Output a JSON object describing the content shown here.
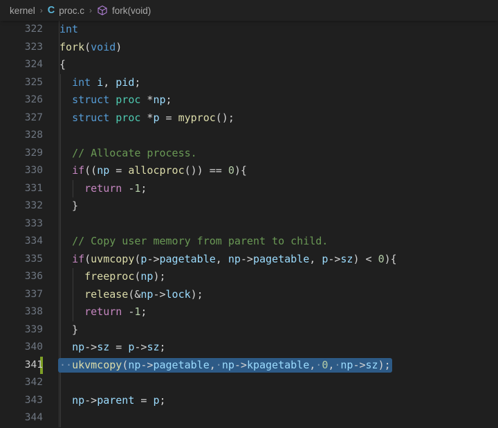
{
  "breadcrumb": {
    "items": [
      {
        "label": "kernel",
        "icon": null
      },
      {
        "label": "proc.c",
        "icon": "c-file-icon"
      },
      {
        "label": "fork(void)",
        "icon": "symbol-method-cube-icon"
      }
    ],
    "separator": "›"
  },
  "editor": {
    "language": "c",
    "theme": "dark",
    "current_line": 341,
    "selection_line": 341,
    "modified_gutter_lines": [
      341
    ],
    "whitespace_dot": "·",
    "colors": {
      "background": "#1f1f1f",
      "breadcrumb_background": "#212121",
      "line_number": "#6e7681",
      "line_number_active": "#cccccc",
      "selection": "#2d5a86",
      "gutter_modified": "#7ea026",
      "indent_guide": "#3b3b3b",
      "keyword": "#569cd6",
      "control": "#c586c0",
      "type": "#4ec9b0",
      "function": "#dcdcaa",
      "variable": "#9cdcfe",
      "number": "#b5cea8",
      "comment": "#6a9955",
      "punctuation": "#d4d4d4"
    },
    "lines": [
      {
        "n": "322",
        "tokens": [
          {
            "t": "int",
            "c": "kw"
          }
        ]
      },
      {
        "n": "323",
        "tokens": [
          {
            "t": "fork",
            "c": "fn"
          },
          {
            "t": "(",
            "c": "punc"
          },
          {
            "t": "void",
            "c": "kw"
          },
          {
            "t": ")",
            "c": "punc"
          }
        ]
      },
      {
        "n": "324",
        "tokens": [
          {
            "t": "{",
            "c": "punc"
          }
        ]
      },
      {
        "n": "325",
        "indents": [
          1
        ],
        "tokens": [
          {
            "t": "  ",
            "c": "punc"
          },
          {
            "t": "int",
            "c": "kw"
          },
          {
            "t": " ",
            "c": "punc"
          },
          {
            "t": "i",
            "c": "var"
          },
          {
            "t": ", ",
            "c": "punc"
          },
          {
            "t": "pid",
            "c": "var"
          },
          {
            "t": ";",
            "c": "punc"
          }
        ]
      },
      {
        "n": "326",
        "indents": [
          1
        ],
        "tokens": [
          {
            "t": "  ",
            "c": "punc"
          },
          {
            "t": "struct",
            "c": "kw"
          },
          {
            "t": " ",
            "c": "punc"
          },
          {
            "t": "proc",
            "c": "type"
          },
          {
            "t": " *",
            "c": "punc"
          },
          {
            "t": "np",
            "c": "var"
          },
          {
            "t": ";",
            "c": "punc"
          }
        ]
      },
      {
        "n": "327",
        "indents": [
          1
        ],
        "tokens": [
          {
            "t": "  ",
            "c": "punc"
          },
          {
            "t": "struct",
            "c": "kw"
          },
          {
            "t": " ",
            "c": "punc"
          },
          {
            "t": "proc",
            "c": "type"
          },
          {
            "t": " *",
            "c": "punc"
          },
          {
            "t": "p",
            "c": "var"
          },
          {
            "t": " = ",
            "c": "punc"
          },
          {
            "t": "myproc",
            "c": "fn"
          },
          {
            "t": "();",
            "c": "punc"
          }
        ]
      },
      {
        "n": "328",
        "indents": [
          1
        ],
        "tokens": []
      },
      {
        "n": "329",
        "indents": [
          1
        ],
        "tokens": [
          {
            "t": "  ",
            "c": "punc"
          },
          {
            "t": "// Allocate process.",
            "c": "cmt"
          }
        ]
      },
      {
        "n": "330",
        "indents": [
          1
        ],
        "tokens": [
          {
            "t": "  ",
            "c": "punc"
          },
          {
            "t": "if",
            "c": "ctrl"
          },
          {
            "t": "((",
            "c": "punc"
          },
          {
            "t": "np",
            "c": "var"
          },
          {
            "t": " = ",
            "c": "punc"
          },
          {
            "t": "allocproc",
            "c": "fn"
          },
          {
            "t": "()) == ",
            "c": "punc"
          },
          {
            "t": "0",
            "c": "num"
          },
          {
            "t": "){",
            "c": "punc"
          }
        ]
      },
      {
        "n": "331",
        "indents": [
          1,
          2
        ],
        "tokens": [
          {
            "t": "    ",
            "c": "punc"
          },
          {
            "t": "return",
            "c": "ctrl"
          },
          {
            "t": " -",
            "c": "punc"
          },
          {
            "t": "1",
            "c": "num"
          },
          {
            "t": ";",
            "c": "punc"
          }
        ]
      },
      {
        "n": "332",
        "indents": [
          1
        ],
        "tokens": [
          {
            "t": "  }",
            "c": "punc"
          }
        ]
      },
      {
        "n": "333",
        "indents": [
          1
        ],
        "tokens": []
      },
      {
        "n": "334",
        "indents": [
          1
        ],
        "tokens": [
          {
            "t": "  ",
            "c": "punc"
          },
          {
            "t": "// Copy user memory from parent to child.",
            "c": "cmt"
          }
        ]
      },
      {
        "n": "335",
        "indents": [
          1
        ],
        "tokens": [
          {
            "t": "  ",
            "c": "punc"
          },
          {
            "t": "if",
            "c": "ctrl"
          },
          {
            "t": "(",
            "c": "punc"
          },
          {
            "t": "uvmcopy",
            "c": "fn"
          },
          {
            "t": "(",
            "c": "punc"
          },
          {
            "t": "p",
            "c": "var"
          },
          {
            "t": "->",
            "c": "punc"
          },
          {
            "t": "pagetable",
            "c": "prop"
          },
          {
            "t": ", ",
            "c": "punc"
          },
          {
            "t": "np",
            "c": "var"
          },
          {
            "t": "->",
            "c": "punc"
          },
          {
            "t": "pagetable",
            "c": "prop"
          },
          {
            "t": ", ",
            "c": "punc"
          },
          {
            "t": "p",
            "c": "var"
          },
          {
            "t": "->",
            "c": "punc"
          },
          {
            "t": "sz",
            "c": "prop"
          },
          {
            "t": ") < ",
            "c": "punc"
          },
          {
            "t": "0",
            "c": "num"
          },
          {
            "t": "){",
            "c": "punc"
          }
        ]
      },
      {
        "n": "336",
        "indents": [
          1,
          2
        ],
        "tokens": [
          {
            "t": "    ",
            "c": "punc"
          },
          {
            "t": "freeproc",
            "c": "fn"
          },
          {
            "t": "(",
            "c": "punc"
          },
          {
            "t": "np",
            "c": "var"
          },
          {
            "t": ");",
            "c": "punc"
          }
        ]
      },
      {
        "n": "337",
        "indents": [
          1,
          2
        ],
        "tokens": [
          {
            "t": "    ",
            "c": "punc"
          },
          {
            "t": "release",
            "c": "fn"
          },
          {
            "t": "(&",
            "c": "punc"
          },
          {
            "t": "np",
            "c": "var"
          },
          {
            "t": "->",
            "c": "punc"
          },
          {
            "t": "lock",
            "c": "prop"
          },
          {
            "t": ");",
            "c": "punc"
          }
        ]
      },
      {
        "n": "338",
        "indents": [
          1,
          2
        ],
        "tokens": [
          {
            "t": "    ",
            "c": "punc"
          },
          {
            "t": "return",
            "c": "ctrl"
          },
          {
            "t": " -",
            "c": "punc"
          },
          {
            "t": "1",
            "c": "num"
          },
          {
            "t": ";",
            "c": "punc"
          }
        ]
      },
      {
        "n": "339",
        "indents": [
          1
        ],
        "tokens": [
          {
            "t": "  }",
            "c": "punc"
          }
        ]
      },
      {
        "n": "340",
        "indents": [
          1
        ],
        "tokens": [
          {
            "t": "  ",
            "c": "punc"
          },
          {
            "t": "np",
            "c": "var"
          },
          {
            "t": "->",
            "c": "punc"
          },
          {
            "t": "sz",
            "c": "prop"
          },
          {
            "t": " = ",
            "c": "punc"
          },
          {
            "t": "p",
            "c": "var"
          },
          {
            "t": "->",
            "c": "punc"
          },
          {
            "t": "sz",
            "c": "prop"
          },
          {
            "t": ";",
            "c": "punc"
          }
        ]
      },
      {
        "n": "341",
        "indents": [
          1
        ],
        "selected": true,
        "current": true,
        "modified": true,
        "tokens": [
          {
            "t": "··",
            "c": "ws"
          },
          {
            "t": "ukvmcopy",
            "c": "fn"
          },
          {
            "t": "(",
            "c": "punc"
          },
          {
            "t": "np",
            "c": "var"
          },
          {
            "t": "->",
            "c": "punc"
          },
          {
            "t": "pagetable",
            "c": "prop"
          },
          {
            "t": ",",
            "c": "punc"
          },
          {
            "t": "·",
            "c": "ws"
          },
          {
            "t": "np",
            "c": "var"
          },
          {
            "t": "->",
            "c": "punc"
          },
          {
            "t": "kpagetable",
            "c": "prop"
          },
          {
            "t": ",",
            "c": "punc"
          },
          {
            "t": "·",
            "c": "ws"
          },
          {
            "t": "0",
            "c": "num"
          },
          {
            "t": ",",
            "c": "punc"
          },
          {
            "t": "·",
            "c": "ws"
          },
          {
            "t": "np",
            "c": "var"
          },
          {
            "t": "->",
            "c": "punc"
          },
          {
            "t": "sz",
            "c": "prop"
          },
          {
            "t": ");",
            "c": "punc"
          }
        ]
      },
      {
        "n": "342",
        "indents": [
          1
        ],
        "tokens": []
      },
      {
        "n": "343",
        "indents": [
          1
        ],
        "tokens": [
          {
            "t": "  ",
            "c": "punc"
          },
          {
            "t": "np",
            "c": "var"
          },
          {
            "t": "->",
            "c": "punc"
          },
          {
            "t": "parent",
            "c": "prop"
          },
          {
            "t": " = ",
            "c": "punc"
          },
          {
            "t": "p",
            "c": "var"
          },
          {
            "t": ";",
            "c": "punc"
          }
        ]
      },
      {
        "n": "344",
        "indents": [
          1
        ],
        "tokens": []
      }
    ]
  }
}
